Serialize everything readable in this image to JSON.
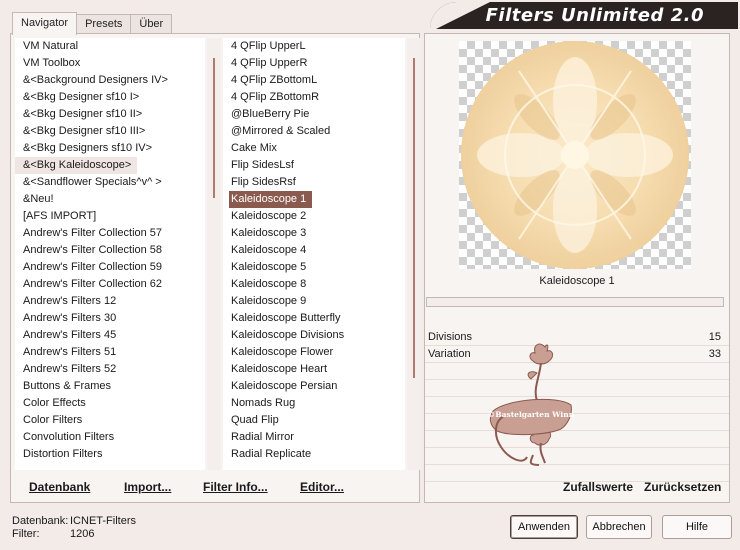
{
  "title": "Filters Unlimited 2.0",
  "tabs": [
    "Navigator",
    "Presets",
    "Über"
  ],
  "categories": [
    "VM Natural",
    "VM Toolbox",
    "&<Background Designers IV>",
    "&<Bkg Designer sf10 I>",
    "&<Bkg Designer sf10 II>",
    "&<Bkg Designer sf10 III>",
    "&<Bkg Designers sf10 IV>",
    "&<Bkg Kaleidoscope>",
    "&<Sandflower Specials^v^ >",
    "&Neu!",
    "[AFS IMPORT]",
    "Andrew's Filter Collection 57",
    "Andrew's Filter Collection 58",
    "Andrew's Filter Collection 59",
    "Andrew's Filter Collection 62",
    "Andrew's Filters 12",
    "Andrew's Filters 30",
    "Andrew's Filters 45",
    "Andrew's Filters 51",
    "Andrew's Filters 52",
    "Buttons & Frames",
    "Color Effects",
    "Color Filters",
    "Convolution Filters",
    "Distortion Filters"
  ],
  "selected_category": "&<Bkg Kaleidoscope>",
  "filters": [
    "4 QFlip UpperL",
    "4 QFlip UpperR",
    "4 QFlip ZBottomL",
    "4 QFlip ZBottomR",
    "@BlueBerry Pie",
    "@Mirrored & Scaled",
    "Cake Mix",
    "Flip SidesLsf",
    "Flip SidesRsf",
    "Kaleidoscope 1",
    "Kaleidoscope 2",
    "Kaleidoscope 3",
    "Kaleidoscope 4",
    "Kaleidoscope 5",
    "Kaleidoscope 8",
    "Kaleidoscope 9",
    "Kaleidoscope Butterfly",
    "Kaleidoscope Divisions",
    "Kaleidoscope Flower",
    "Kaleidoscope Heart",
    "Kaleidoscope Persian",
    "Nomads Rug",
    "Quad Flip",
    "Radial Mirror",
    "Radial Replicate"
  ],
  "selected_filter": "Kaleidoscope 1",
  "left_buttons": {
    "database": "Datenbank",
    "import": "Import...",
    "filter_info": "Filter Info...",
    "editor": "Editor..."
  },
  "preview_label": "Kaleidoscope 1",
  "params": [
    {
      "name": "Divisions",
      "value": "15"
    },
    {
      "name": "Variation",
      "value": "33"
    }
  ],
  "watermark": "©Bastelgarten Winn",
  "right_buttons": {
    "random": "Zufallswerte",
    "reset": "Zurücksetzen"
  },
  "status": {
    "database_label": "Datenbank:",
    "database_value": "ICNET-Filters",
    "filter_label": "Filter:",
    "filter_value": "1206"
  },
  "dialog_buttons": {
    "apply": "Anwenden",
    "cancel": "Abbrechen",
    "help": "Hilfe"
  },
  "colors": {
    "selection": "#8b5a4f",
    "banner": "#2b2321",
    "background": "#f2ebe8"
  }
}
